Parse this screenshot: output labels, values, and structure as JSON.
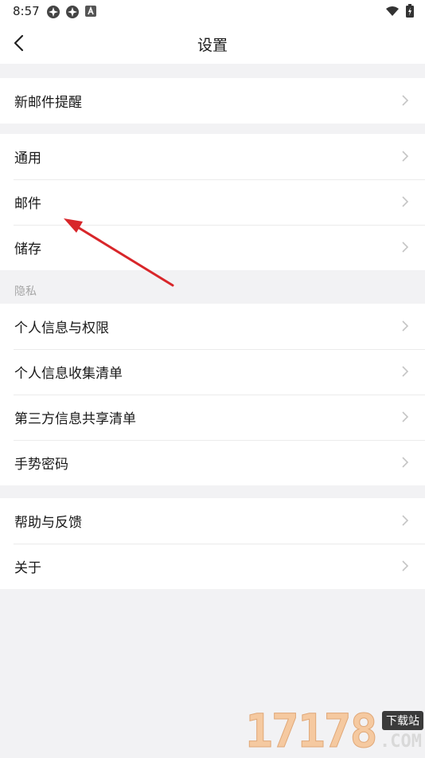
{
  "status_bar": {
    "time": "8:57",
    "left_icons": [
      "app-notification-icon",
      "app-notification-icon",
      "android-a-icon"
    ],
    "right_icons": [
      "wifi-icon",
      "battery-charging-icon"
    ]
  },
  "header": {
    "title": "设置",
    "back_icon": "back-chevron-icon"
  },
  "sections": {
    "notify": {
      "items": [
        {
          "label": "新邮件提醒"
        }
      ]
    },
    "general": {
      "items": [
        {
          "label": "通用"
        },
        {
          "label": "邮件"
        },
        {
          "label": "储存"
        }
      ]
    },
    "privacy": {
      "header": "隐私",
      "items": [
        {
          "label": "个人信息与权限"
        },
        {
          "label": "个人信息收集清单"
        },
        {
          "label": "第三方信息共享清单"
        },
        {
          "label": "手势密码"
        }
      ]
    },
    "about": {
      "items": [
        {
          "label": "帮助与反馈"
        },
        {
          "label": "关于"
        }
      ]
    }
  },
  "annotation": {
    "arrow_color": "#d8262a"
  },
  "watermark": {
    "digits": "17178",
    "badge": "下载站",
    "domain": ".COM"
  },
  "colors": {
    "background": "#f2f2f4",
    "surface": "#ffffff",
    "divider": "#ebebeb",
    "section_header": "#a6a6a6"
  }
}
